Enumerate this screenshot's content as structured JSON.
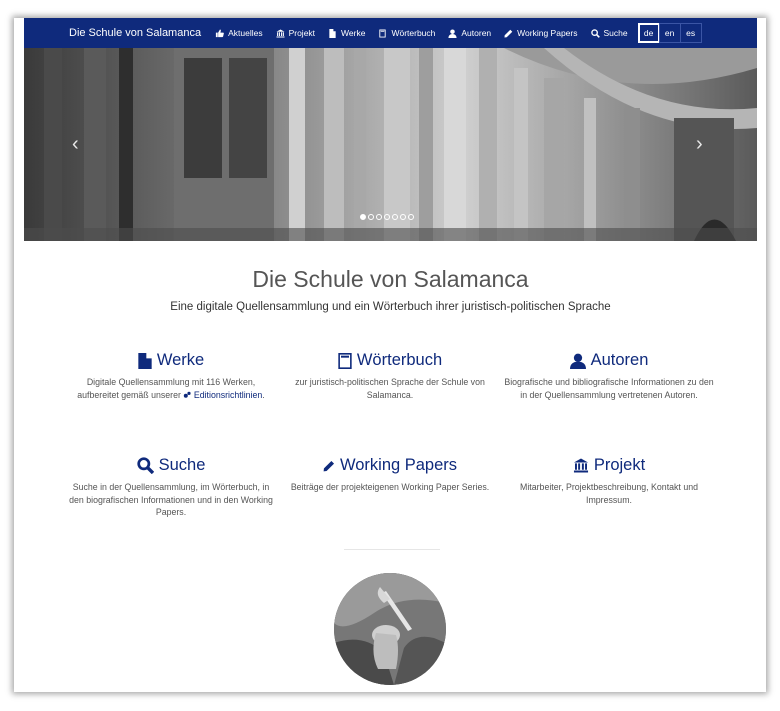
{
  "navbar": {
    "brand": "Die Schule von Salamanca",
    "items": [
      {
        "label": "Aktuelles",
        "icon": "thumbs-up-icon"
      },
      {
        "label": "Projekt",
        "icon": "institution-icon"
      },
      {
        "label": "Werke",
        "icon": "file-icon"
      },
      {
        "label": "Wörterbuch",
        "icon": "book-icon"
      },
      {
        "label": "Autoren",
        "icon": "user-icon"
      },
      {
        "label": "Working Papers",
        "icon": "pencil-icon"
      },
      {
        "label": "Suche",
        "icon": "search-icon"
      }
    ],
    "languages": [
      "de",
      "en",
      "es"
    ],
    "active_language": "de"
  },
  "carousel": {
    "prev_glyph": "‹",
    "next_glyph": "›",
    "slide_count": 7,
    "active_slide": 1
  },
  "hero": {
    "title": "Die Schule von Salamanca",
    "subtitle": "Eine digitale Quellensammlung und ein Wörterbuch ihrer juristisch-politischen Sprache"
  },
  "features": {
    "werke": {
      "title": "Werke",
      "icon": "file-icon",
      "desc": "Digitale Quellensammlung mit 116 Werken, aufbereitet gemäß unserer",
      "link": "Editionsrichtlinien",
      "tail": "."
    },
    "woerterbuch": {
      "title": "Wörterbuch",
      "icon": "book-icon",
      "desc": "zur juristisch-politischen Sprache der Schule von Salamanca."
    },
    "autoren": {
      "title": "Autoren",
      "icon": "user-icon",
      "desc": "Biografische und bibliografische Informationen zu den in der Quellensammlung vertretenen Autoren."
    },
    "suche": {
      "title": "Suche",
      "icon": "search-icon",
      "desc": "Suche in der Quellensammlung, im Wörterbuch, in den biografischen Informationen und in den Working Papers."
    },
    "working_papers": {
      "title": "Working Papers",
      "icon": "pencil-icon",
      "desc": "Beiträge der projekteigenen Working Paper Series."
    },
    "projekt": {
      "title": "Projekt",
      "icon": "institution-icon",
      "desc": "Mitarbeiter, Projektbeschreibung, Kontakt und Impressum."
    }
  },
  "colors": {
    "brand_navy": "#0f2a7c",
    "text_gray": "#555555"
  }
}
